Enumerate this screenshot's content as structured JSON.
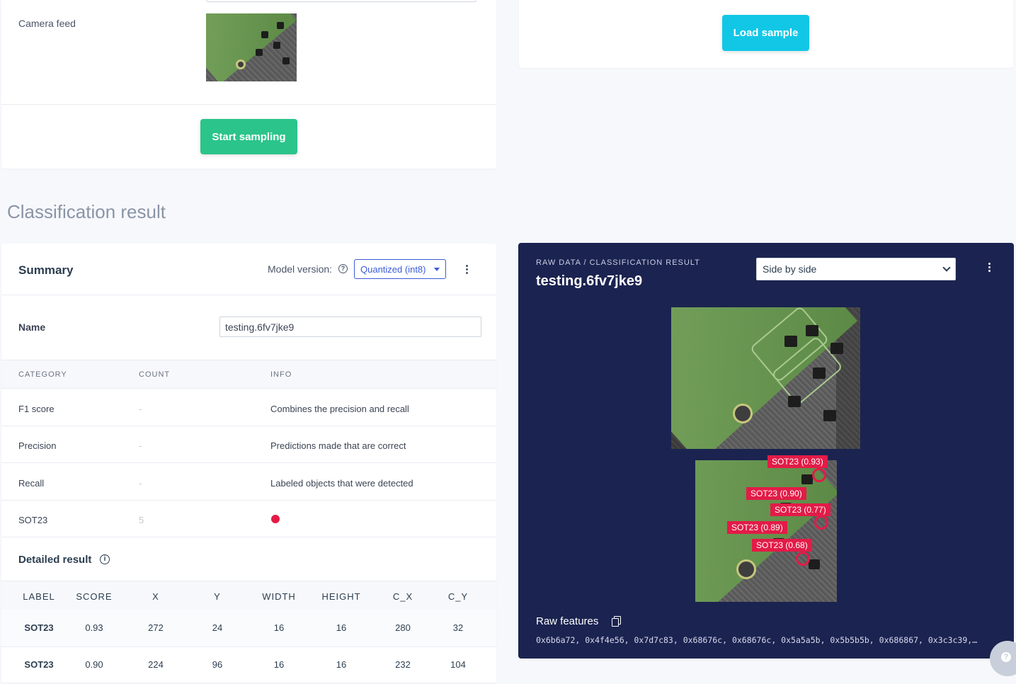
{
  "top": {
    "camera_label": "Camera feed",
    "start_button": "Start sampling",
    "load_button": "Load sample"
  },
  "section_title": "Classification result",
  "summary": {
    "title": "Summary",
    "model_version_label": "Model version:",
    "model_version_value": "Quantized (int8)",
    "name_label": "Name",
    "name_value": "testing.6fv7jke9",
    "headers": [
      "CATEGORY",
      "COUNT",
      "INFO"
    ],
    "rows": [
      {
        "category": "F1 score",
        "count": "-",
        "info": "Combines the precision and recall"
      },
      {
        "category": "Precision",
        "count": "-",
        "info": "Predictions made that are correct"
      },
      {
        "category": "Recall",
        "count": "-",
        "info": "Labeled objects that were detected"
      },
      {
        "category": "SOT23",
        "count": "5",
        "info": ""
      }
    ],
    "class_color": "#e31b47"
  },
  "detailed": {
    "title": "Detailed result",
    "headers": [
      "LABEL",
      "SCORE",
      "X",
      "Y",
      "WIDTH",
      "HEIGHT",
      "C_X",
      "C_Y"
    ],
    "rows": [
      [
        "SOT23",
        "0.93",
        "272",
        "24",
        "16",
        "16",
        "280",
        "32"
      ],
      [
        "SOT23",
        "0.90",
        "224",
        "96",
        "16",
        "16",
        "232",
        "104"
      ]
    ]
  },
  "raw": {
    "breadcrumb": "RAW DATA / CLASSIFICATION RESULT",
    "sample_name": "testing.6fv7jke9",
    "view_select": "Side by side",
    "boxes": [
      "SOT23 (0.93)",
      "SOT23 (0.90)",
      "SOT23 (0.77)",
      "SOT23 (0.89)",
      "SOT23 (0.68)"
    ],
    "features_label": "Raw features",
    "features_value": "0x6b6a72, 0x4f4e56, 0x7d7c83, 0x68676c, 0x68676c, 0x5a5a5b, 0x5b5b5b, 0x686867, 0x3c3c39,…"
  },
  "icons": [
    "help-icon",
    "caret-down-icon",
    "kebab-menu-icon",
    "info-icon",
    "copy-icon",
    "chevron-down-icon"
  ],
  "colors": {
    "start_button": "#2bc48a",
    "load_button": "#12c7e6",
    "panel_dark": "#1b2350",
    "accent_blue": "#3b5bdb",
    "box": "#e31b47"
  }
}
